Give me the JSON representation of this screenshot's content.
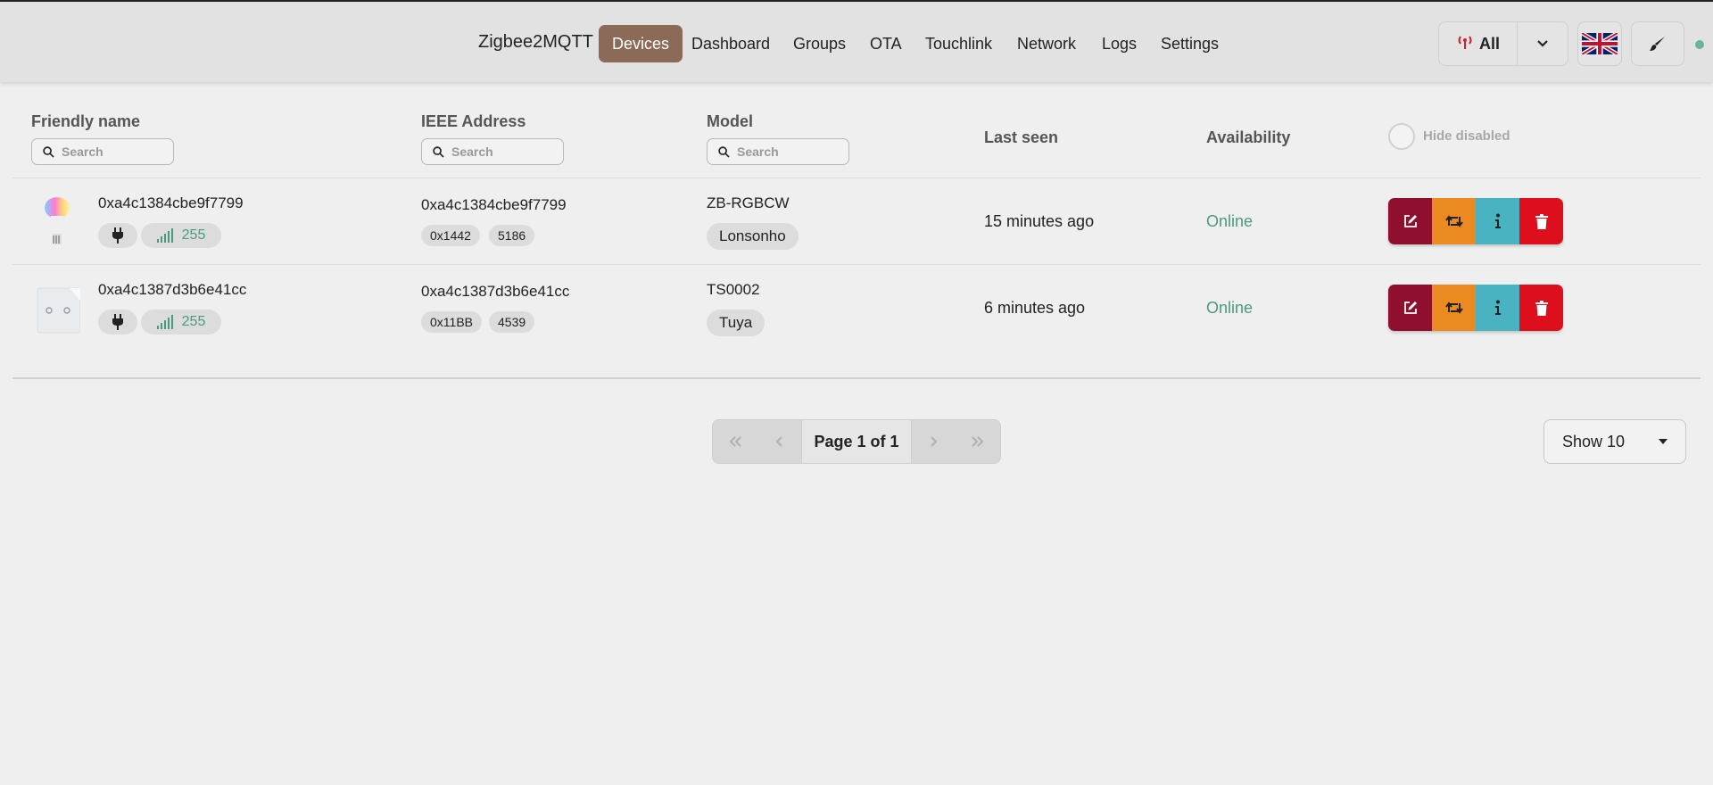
{
  "nav": {
    "brand": "Zigbee2MQTT",
    "items": [
      "Devices",
      "Dashboard",
      "Groups",
      "OTA",
      "Touchlink",
      "Network",
      "Logs",
      "Settings"
    ],
    "active": "Devices"
  },
  "toolbar": {
    "permit_join_label": "All",
    "language": "en-GB"
  },
  "table": {
    "headers": {
      "friendly_name": "Friendly name",
      "ieee": "IEEE Address",
      "model": "Model",
      "last_seen": "Last seen",
      "availability": "Availability",
      "hide_disabled": "Hide disabled"
    },
    "search_placeholder": "Search",
    "rows": [
      {
        "friendly_name": "0xa4c1384cbe9f7799",
        "lqi": "255",
        "ieee": "0xa4c1384cbe9f7799",
        "nwk": "0x1442",
        "nwk_dec": "5186",
        "model": "ZB-RGBCW",
        "vendor": "Lonsonho",
        "last_seen": "15 minutes ago",
        "availability": "Online"
      },
      {
        "friendly_name": "0xa4c1387d3b6e41cc",
        "lqi": "255",
        "ieee": "0xa4c1387d3b6e41cc",
        "nwk": "0x11BB",
        "nwk_dec": "4539",
        "model": "TS0002",
        "vendor": "Tuya",
        "last_seen": "6 minutes ago",
        "availability": "Online"
      }
    ]
  },
  "pagination": {
    "page_label": "Page 1 of 1",
    "page_size_label": "Show 10"
  },
  "colors": {
    "active_nav": "#8c6a58",
    "online": "#4a9a7e",
    "edit": "#8f0f2f",
    "swap": "#ec8a22",
    "info": "#4ab3c2",
    "delete": "#dd0f1d"
  }
}
